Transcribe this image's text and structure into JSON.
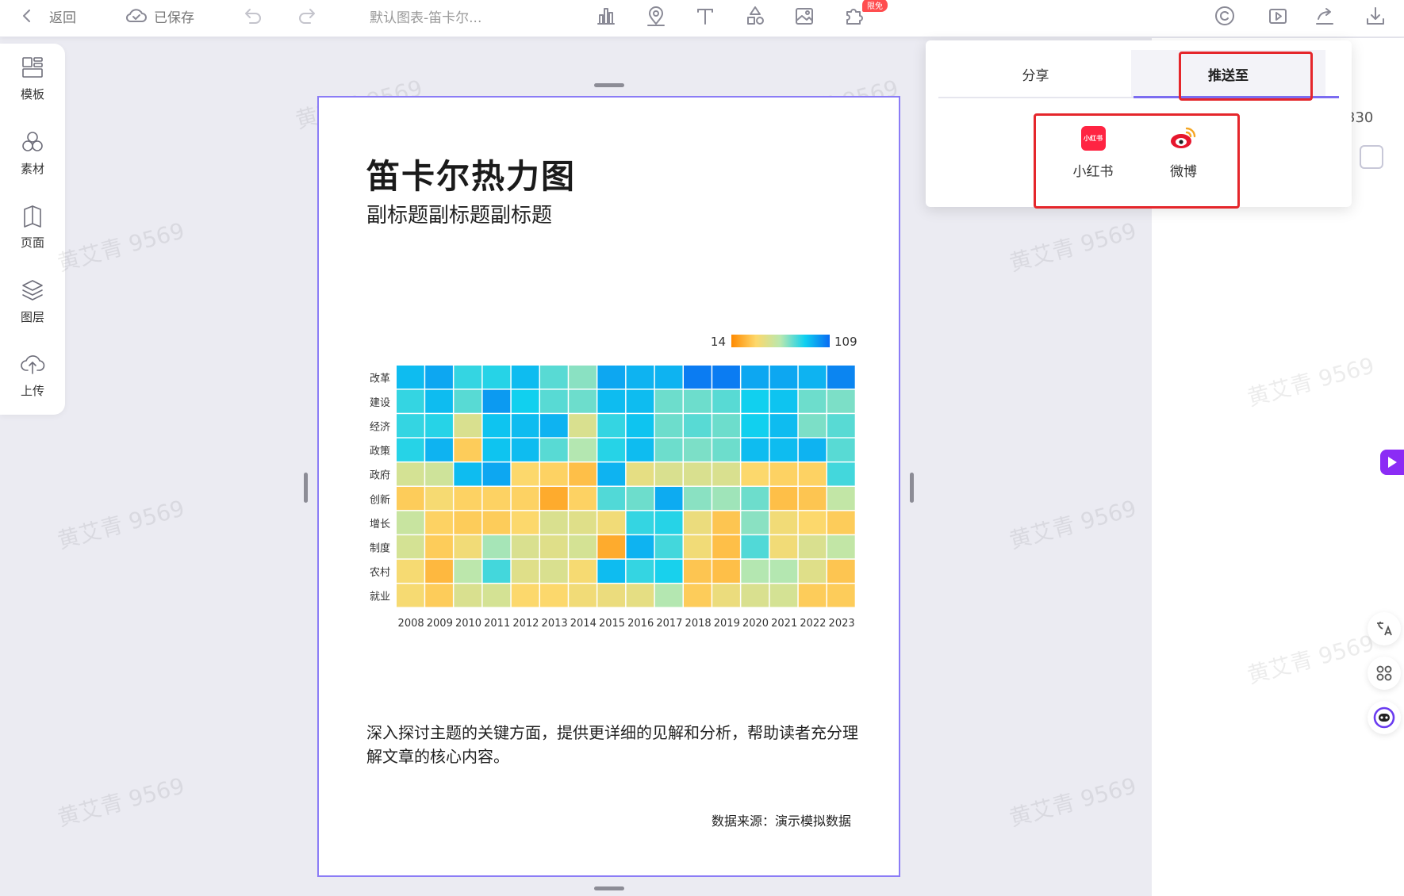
{
  "topbar": {
    "back_label": "返回",
    "saved_label": "已保存",
    "doc_title": "默认图表-笛卡尔...",
    "badge_label": "限免",
    "icons": [
      "chart-icon",
      "map-pin-icon",
      "text-icon",
      "shapes-icon",
      "image-icon",
      "plugin-icon",
      "copyright-icon",
      "play-icon",
      "share-icon",
      "download-icon"
    ]
  },
  "sidebar": {
    "items": [
      {
        "label": "模板",
        "icon": "template-icon"
      },
      {
        "label": "素材",
        "icon": "material-icon"
      },
      {
        "label": "页面",
        "icon": "page-icon"
      },
      {
        "label": "图层",
        "icon": "layers-icon"
      },
      {
        "label": "上传",
        "icon": "upload-icon"
      }
    ]
  },
  "share_popup": {
    "tabs": [
      {
        "label": "分享",
        "active": false
      },
      {
        "label": "推送至",
        "active": true
      }
    ],
    "platforms": [
      {
        "label": "小红书",
        "icon": "xiaohongshu-icon",
        "icon_text": "小红书"
      },
      {
        "label": "微博",
        "icon": "weibo-icon"
      }
    ]
  },
  "right_panel": {
    "partial_value": "330"
  },
  "watermark": "黄艾青 9569",
  "chart_data": {
    "type": "heatmap",
    "title": "笛卡尔热力图",
    "subtitle": "副标题副标题副标题",
    "x": [
      "2008",
      "2009",
      "2010",
      "2011",
      "2012",
      "2013",
      "2014",
      "2015",
      "2016",
      "2017",
      "2018",
      "2019",
      "2020",
      "2021",
      "2022",
      "2023"
    ],
    "y": [
      "改革",
      "建设",
      "经济",
      "政策",
      "政府",
      "创新",
      "增长",
      "制度",
      "农村",
      "就业"
    ],
    "scale": {
      "min": 14,
      "max": 109
    },
    "values": [
      [
        90,
        95,
        80,
        82,
        90,
        75,
        68,
        95,
        92,
        92,
        105,
        105,
        95,
        95,
        92,
        103
      ],
      [
        80,
        90,
        75,
        98,
        85,
        75,
        72,
        90,
        90,
        72,
        72,
        75,
        85,
        88,
        72,
        70
      ],
      [
        80,
        82,
        50,
        88,
        90,
        92,
        50,
        80,
        88,
        72,
        75,
        72,
        85,
        90,
        70,
        75
      ],
      [
        82,
        92,
        34,
        88,
        90,
        75,
        62,
        82,
        90,
        72,
        70,
        72,
        90,
        90,
        92,
        75
      ],
      [
        52,
        54,
        90,
        95,
        38,
        36,
        30,
        92,
        46,
        50,
        50,
        50,
        38,
        36,
        36,
        78
      ],
      [
        34,
        40,
        36,
        36,
        36,
        24,
        36,
        76,
        72,
        94,
        68,
        65,
        72,
        30,
        32,
        58
      ],
      [
        56,
        36,
        34,
        34,
        38,
        50,
        48,
        42,
        80,
        82,
        44,
        32,
        68,
        42,
        38,
        34
      ],
      [
        52,
        34,
        42,
        64,
        50,
        48,
        52,
        24,
        92,
        78,
        42,
        30,
        76,
        42,
        50,
        58
      ],
      [
        40,
        28,
        60,
        78,
        48,
        50,
        40,
        90,
        80,
        84,
        32,
        30,
        62,
        62,
        48,
        32
      ],
      [
        40,
        34,
        50,
        52,
        38,
        38,
        42,
        44,
        46,
        62,
        34,
        44,
        50,
        52,
        34,
        34
      ]
    ],
    "description": "深入探讨主题的关键方面，提供更详细的见解和分析，帮助读者充分理解文章的核心内容。",
    "source": "数据来源：演示模拟数据"
  }
}
